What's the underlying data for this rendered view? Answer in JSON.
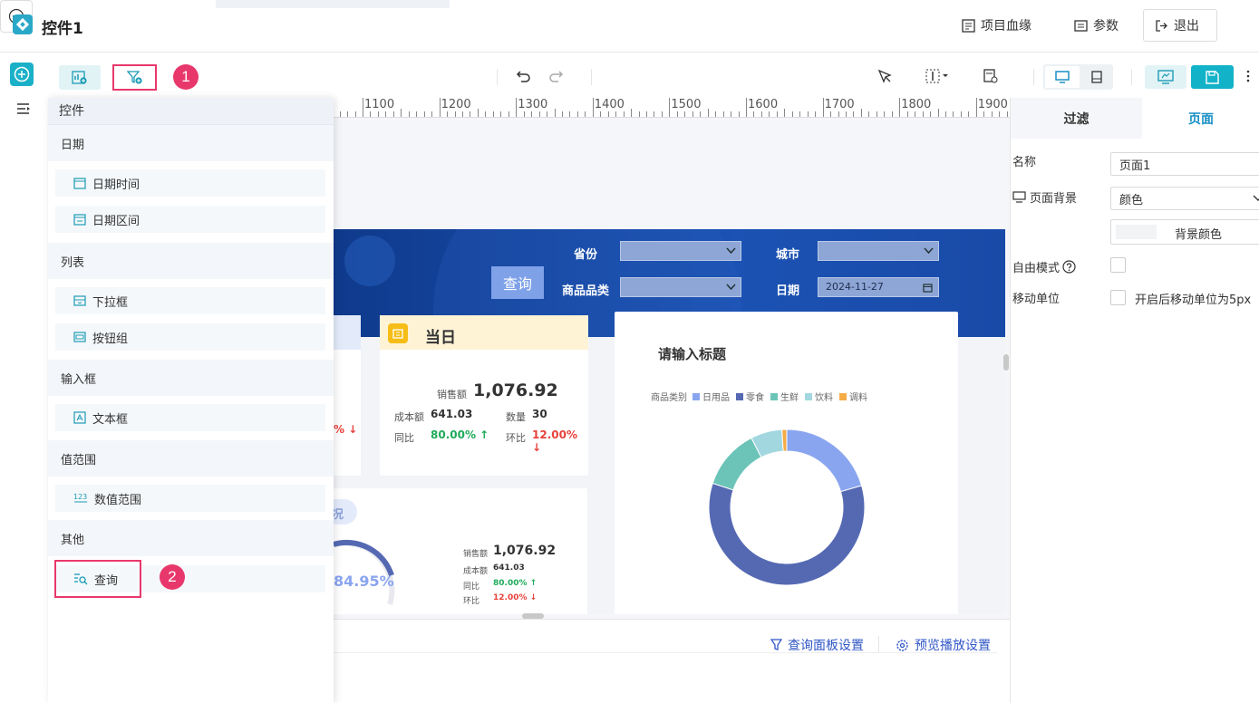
{
  "app": {
    "title": "控件1"
  },
  "header": {
    "lineage_label": "项目血缘",
    "params_label": "参数",
    "exit_label": "退出"
  },
  "annotations": {
    "badge1": "1",
    "badge2": "2"
  },
  "panel": {
    "title": "控件",
    "sections": [
      {
        "label": "日期",
        "items": [
          "日期时间",
          "日期区间"
        ]
      },
      {
        "label": "列表",
        "items": [
          "下拉框",
          "按钮组"
        ]
      },
      {
        "label": "输入框",
        "items": [
          "文本框"
        ]
      },
      {
        "label": "值范围",
        "items": [
          "数值范围"
        ]
      },
      {
        "label": "其他",
        "items": [
          "查询"
        ]
      }
    ]
  },
  "ruler": {
    "labels": [
      "1100",
      "1200",
      "1300",
      "1400",
      "1500",
      "1600",
      "1700",
      "1800",
      "1900"
    ]
  },
  "dashboard": {
    "query_button": "查询",
    "filters": {
      "province": "省份",
      "city": "城市",
      "category": "商品品类",
      "date": "日期",
      "date_value": "2024-11-27"
    },
    "today_card": {
      "title": "当日",
      "sales_label": "销售额",
      "sales_value": "1,076.92",
      "cost_label": "成本额",
      "cost_value": "641.03",
      "qty_label": "数量",
      "qty_value": "30",
      "yoy_label": "同比",
      "yoy_value": "80.00%",
      "mom_label": "环比",
      "mom_value": "12.00%"
    },
    "left_card": {
      "partial_value": "%"
    },
    "bottom_card": {
      "title_fragment": "况",
      "gauge_value": "84.95%",
      "sales_label": "销售额",
      "sales_value": "1,076.92",
      "cost_label": "成本额",
      "cost_value": "641.03",
      "yoy_label": "同比",
      "yoy_value": "80.00%",
      "mom_label": "环比",
      "mom_value": "12.00%"
    }
  },
  "chart_data": {
    "type": "pie",
    "title": "请输入标题",
    "legend_title": "商品类别",
    "legend_position": "top",
    "categories": [
      "日用品",
      "零食",
      "生鲜",
      "饮料",
      "调料"
    ],
    "values": [
      20.5,
      59.5,
      12.5,
      6.5,
      1.0
    ],
    "colors": [
      "#8aa5f0",
      "#5569b3",
      "#6cc4b8",
      "#a2d7e0",
      "#f6ac47"
    ]
  },
  "canvas_footer": {
    "query_panel_settings": "查询面板设置",
    "preview_settings": "预览播放设置"
  },
  "right_panel": {
    "tabs": [
      "过滤",
      "页面"
    ],
    "active_tab": "页面",
    "name_label": "名称",
    "name_value": "页面1",
    "bg_label": "页面背景",
    "bg_type": "颜色",
    "bg_color_label": "背景颜色",
    "free_mode_label": "自由模式",
    "move_unit_label": "移动单位",
    "move_unit_text": "开启后移动单位为5px"
  },
  "colors": {
    "accent": "#1ab0c8",
    "annotation": "#e8386b",
    "dash_header": "#1b4aa6",
    "active_tab": "#1a8fc4"
  }
}
